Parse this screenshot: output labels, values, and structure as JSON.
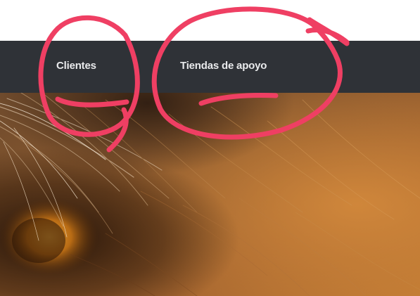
{
  "nav": {
    "items": [
      {
        "label": "Clientes"
      },
      {
        "label": "Tiendas de apoyo"
      }
    ]
  },
  "hero": {
    "image": "lion-fur-eye-closeup"
  },
  "annotation": {
    "color": "#ef3f63"
  },
  "colors": {
    "navbar_bg": "#2f3237",
    "nav_text": "#e9eaec"
  }
}
